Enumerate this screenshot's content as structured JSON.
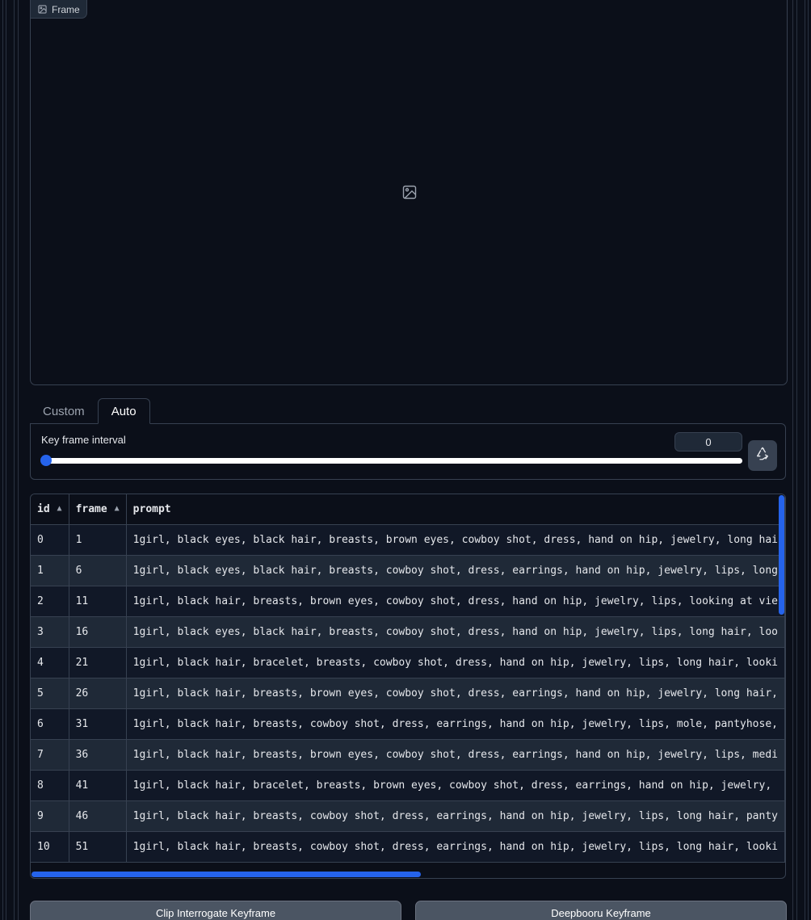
{
  "frame": {
    "label": "Frame",
    "label_icon": "image-icon",
    "placeholder_icon": "image-placeholder-icon"
  },
  "tabs": [
    {
      "label": "Custom",
      "active": false
    },
    {
      "label": "Auto",
      "active": true
    }
  ],
  "key_frame_interval": {
    "label": "Key frame interval",
    "value": "0",
    "slider_fraction": 0,
    "reset_icon": "recycle-icon"
  },
  "table": {
    "headers": [
      "id",
      "frame",
      "prompt"
    ],
    "rows": [
      [
        "0",
        "1",
        "1girl, black eyes, black hair, breasts, brown eyes, cowboy shot, dress, hand on hip, jewelry, long hai"
      ],
      [
        "1",
        "6",
        "1girl, black eyes, black hair, breasts, cowboy shot, dress, earrings, hand on hip, jewelry, lips, long"
      ],
      [
        "2",
        "11",
        "1girl, black hair, breasts, brown eyes, cowboy shot, dress, hand on hip, jewelry, lips, looking at vie"
      ],
      [
        "3",
        "16",
        "1girl, black eyes, black hair, breasts, cowboy shot, dress, hand on hip, jewelry, lips, long hair, loo"
      ],
      [
        "4",
        "21",
        "1girl, black hair, bracelet, breasts, cowboy shot, dress, hand on hip, jewelry, lips, long hair, looki"
      ],
      [
        "5",
        "26",
        "1girl, black hair, breasts, brown eyes, cowboy shot, dress, earrings, hand on hip, jewelry, long hair,"
      ],
      [
        "6",
        "31",
        "1girl, black hair, breasts, cowboy shot, dress, earrings, hand on hip, jewelry, lips, mole, pantyhose,"
      ],
      [
        "7",
        "36",
        "1girl, black hair, breasts, brown eyes, cowboy shot, dress, earrings, hand on hip, jewelry, lips, medi"
      ],
      [
        "8",
        "41",
        "1girl, black hair, bracelet, breasts, brown eyes, cowboy shot, dress, earrings, hand on hip, jewelry,"
      ],
      [
        "9",
        "46",
        "1girl, black hair, breasts, cowboy shot, dress, earrings, hand on hip, jewelry, lips, long hair, panty"
      ],
      [
        "10",
        "51",
        "1girl, black hair, breasts, cowboy shot, dress, earrings, hand on hip, jewelry, lips, long hair, looki"
      ]
    ]
  },
  "buttons": {
    "clip": "Clip Interrogate Keyframe",
    "deepbooru": "Deepbooru Keyframe"
  },
  "colors": {
    "background": "#0b0f19",
    "accent": "#2563eb",
    "border": "#374151"
  }
}
